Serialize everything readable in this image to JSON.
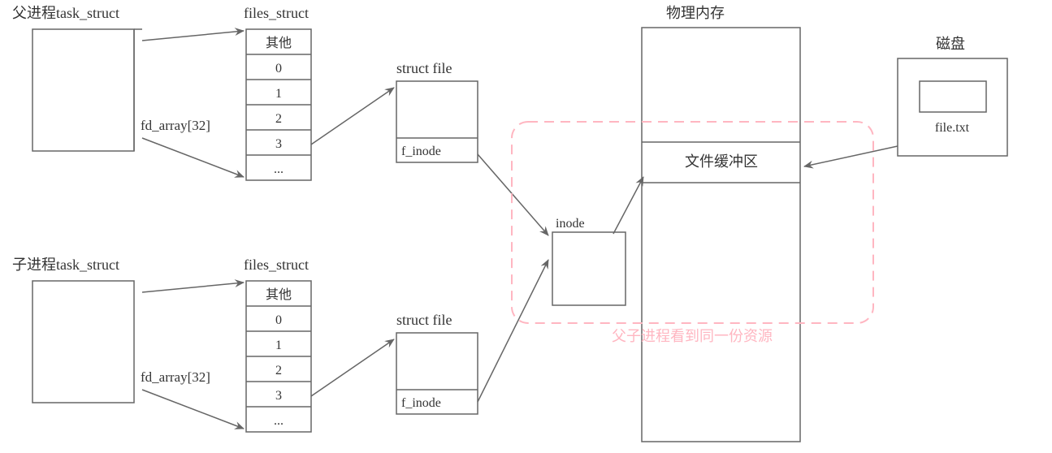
{
  "parent": {
    "title": "父进程task_struct",
    "files_struct_label": "files_struct",
    "fd_array_label": "fd_array[32]",
    "rows": {
      "other": "其他",
      "r0": "0",
      "r1": "1",
      "r2": "2",
      "r3": "3",
      "dots": "..."
    }
  },
  "child": {
    "title": "子进程task_struct",
    "files_struct_label": "files_struct",
    "fd_array_label": "fd_array[32]",
    "rows": {
      "other": "其他",
      "r0": "0",
      "r1": "1",
      "r2": "2",
      "r3": "3",
      "dots": "..."
    }
  },
  "structfile": {
    "label": "struct file",
    "f_inode": "f_inode"
  },
  "inode": {
    "label": "inode"
  },
  "memory": {
    "title": "物理内存",
    "buffer_label": "文件缓冲区"
  },
  "disk": {
    "title": "磁盘",
    "filename": "file.txt"
  },
  "annotation": "父子进程看到同一份资源"
}
